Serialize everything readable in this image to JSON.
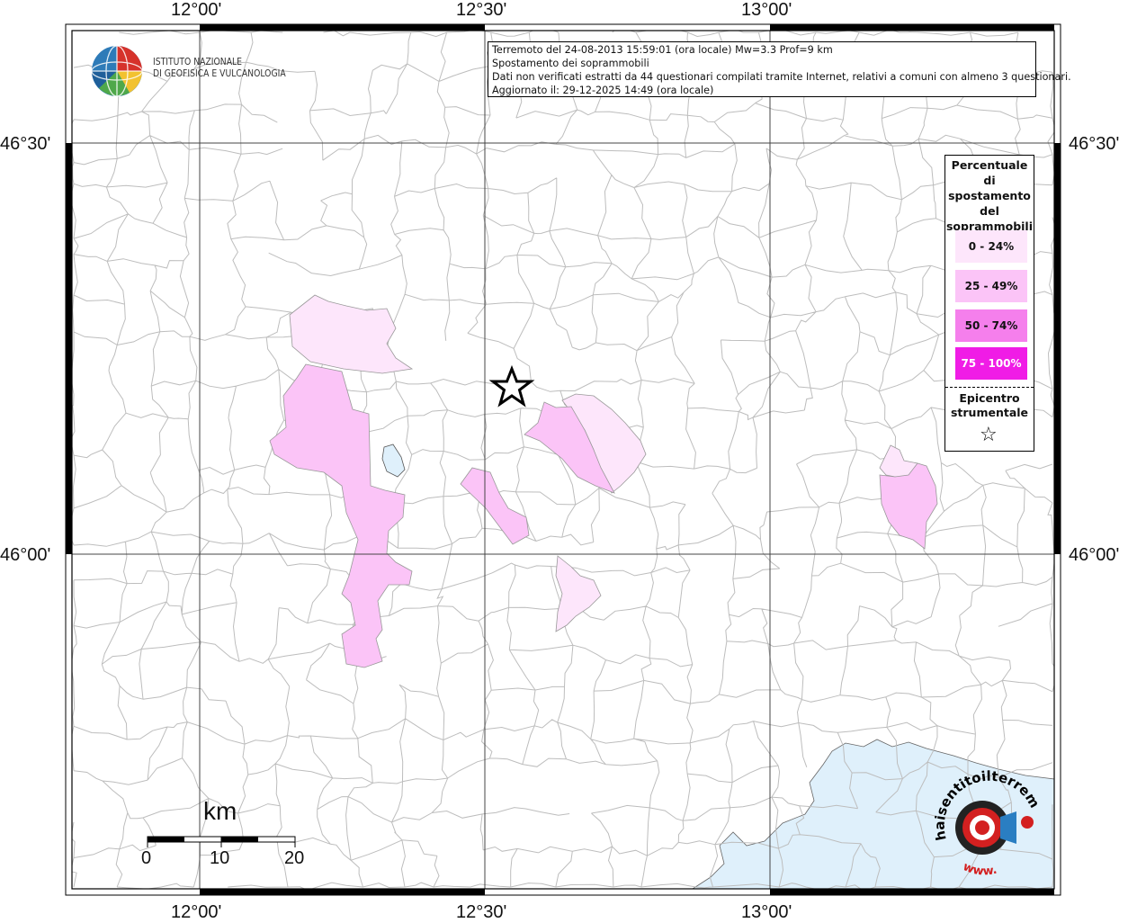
{
  "axes": {
    "lon_labels": [
      "12°00'",
      "12°30'",
      "13°00'"
    ],
    "lat_labels": [
      "46°30'",
      "46°00'"
    ]
  },
  "info": {
    "line1": "Terremoto del 24-08-2013 15:59:01 (ora locale) Mw=3.3 Prof=9 km",
    "line2": "Spostamento dei soprammobili",
    "line3": "Dati non verificati estratti da 44 questionari compilati tramite Internet, relativi a comuni con almeno 3 questionari.",
    "line4": "Aggiornato il: 29-12-2025 14:49 (ora locale)"
  },
  "ingv": {
    "line1": "ISTITUTO NAZIONALE",
    "line2": "DI GEOFISICA E VULCANOLOGIA"
  },
  "legend": {
    "title_lines": [
      "Percentuale",
      "di",
      "spostamento",
      "del",
      "soprammobili"
    ],
    "items": [
      {
        "label": "0 - 24%",
        "color": "#fde6fb"
      },
      {
        "label": "25 - 49%",
        "color": "#fbc4f7"
      },
      {
        "label": "50 - 74%",
        "color": "#f57fec"
      },
      {
        "label": "75 - 100%",
        "color": "#f01ce6"
      }
    ],
    "epicenter_lines": [
      "Epicentro",
      "strumentale"
    ],
    "epicenter_symbol": "☆"
  },
  "scale": {
    "unit": "km",
    "ticks": [
      "0",
      "10",
      "20"
    ]
  },
  "logo": {
    "text": "haisentitoilterremoto.it",
    "url_text": "www."
  },
  "colors": {
    "sea": "#dff0fb",
    "border": "#000000",
    "grid": "#333333",
    "municipal": "#bdbdbd"
  }
}
